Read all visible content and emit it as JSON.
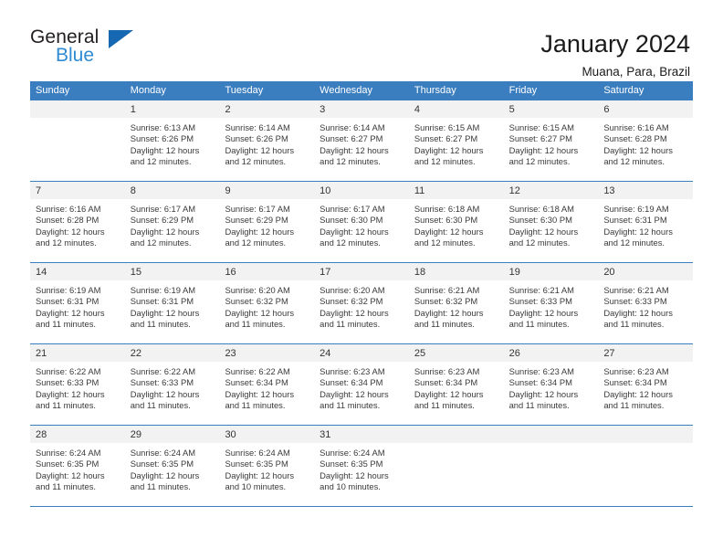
{
  "brand": {
    "name_part1": "General",
    "name_part2": "Blue",
    "triangle_color": "#1668b3",
    "blue_color": "#2e8bd4"
  },
  "header": {
    "title": "January 2024",
    "subtitle": "Muana, Para, Brazil"
  },
  "theme": {
    "header_blue": "#3b7ebf",
    "daynum_bg": "#f2f2f2",
    "text": "#3a3a3a"
  },
  "weekdays": [
    "Sunday",
    "Monday",
    "Tuesday",
    "Wednesday",
    "Thursday",
    "Friday",
    "Saturday"
  ],
  "labels": {
    "sunrise": "Sunrise:",
    "sunset": "Sunset:",
    "daylight": "Daylight:"
  },
  "weeks": [
    [
      {
        "day": ""
      },
      {
        "day": "1",
        "sunrise": "Sunrise: 6:13 AM",
        "sunset": "Sunset: 6:26 PM",
        "daylight1": "Daylight: 12 hours",
        "daylight2": "and 12 minutes."
      },
      {
        "day": "2",
        "sunrise": "Sunrise: 6:14 AM",
        "sunset": "Sunset: 6:26 PM",
        "daylight1": "Daylight: 12 hours",
        "daylight2": "and 12 minutes."
      },
      {
        "day": "3",
        "sunrise": "Sunrise: 6:14 AM",
        "sunset": "Sunset: 6:27 PM",
        "daylight1": "Daylight: 12 hours",
        "daylight2": "and 12 minutes."
      },
      {
        "day": "4",
        "sunrise": "Sunrise: 6:15 AM",
        "sunset": "Sunset: 6:27 PM",
        "daylight1": "Daylight: 12 hours",
        "daylight2": "and 12 minutes."
      },
      {
        "day": "5",
        "sunrise": "Sunrise: 6:15 AM",
        "sunset": "Sunset: 6:27 PM",
        "daylight1": "Daylight: 12 hours",
        "daylight2": "and 12 minutes."
      },
      {
        "day": "6",
        "sunrise": "Sunrise: 6:16 AM",
        "sunset": "Sunset: 6:28 PM",
        "daylight1": "Daylight: 12 hours",
        "daylight2": "and 12 minutes."
      }
    ],
    [
      {
        "day": "7",
        "sunrise": "Sunrise: 6:16 AM",
        "sunset": "Sunset: 6:28 PM",
        "daylight1": "Daylight: 12 hours",
        "daylight2": "and 12 minutes."
      },
      {
        "day": "8",
        "sunrise": "Sunrise: 6:17 AM",
        "sunset": "Sunset: 6:29 PM",
        "daylight1": "Daylight: 12 hours",
        "daylight2": "and 12 minutes."
      },
      {
        "day": "9",
        "sunrise": "Sunrise: 6:17 AM",
        "sunset": "Sunset: 6:29 PM",
        "daylight1": "Daylight: 12 hours",
        "daylight2": "and 12 minutes."
      },
      {
        "day": "10",
        "sunrise": "Sunrise: 6:17 AM",
        "sunset": "Sunset: 6:30 PM",
        "daylight1": "Daylight: 12 hours",
        "daylight2": "and 12 minutes."
      },
      {
        "day": "11",
        "sunrise": "Sunrise: 6:18 AM",
        "sunset": "Sunset: 6:30 PM",
        "daylight1": "Daylight: 12 hours",
        "daylight2": "and 12 minutes."
      },
      {
        "day": "12",
        "sunrise": "Sunrise: 6:18 AM",
        "sunset": "Sunset: 6:30 PM",
        "daylight1": "Daylight: 12 hours",
        "daylight2": "and 12 minutes."
      },
      {
        "day": "13",
        "sunrise": "Sunrise: 6:19 AM",
        "sunset": "Sunset: 6:31 PM",
        "daylight1": "Daylight: 12 hours",
        "daylight2": "and 12 minutes."
      }
    ],
    [
      {
        "day": "14",
        "sunrise": "Sunrise: 6:19 AM",
        "sunset": "Sunset: 6:31 PM",
        "daylight1": "Daylight: 12 hours",
        "daylight2": "and 11 minutes."
      },
      {
        "day": "15",
        "sunrise": "Sunrise: 6:19 AM",
        "sunset": "Sunset: 6:31 PM",
        "daylight1": "Daylight: 12 hours",
        "daylight2": "and 11 minutes."
      },
      {
        "day": "16",
        "sunrise": "Sunrise: 6:20 AM",
        "sunset": "Sunset: 6:32 PM",
        "daylight1": "Daylight: 12 hours",
        "daylight2": "and 11 minutes."
      },
      {
        "day": "17",
        "sunrise": "Sunrise: 6:20 AM",
        "sunset": "Sunset: 6:32 PM",
        "daylight1": "Daylight: 12 hours",
        "daylight2": "and 11 minutes."
      },
      {
        "day": "18",
        "sunrise": "Sunrise: 6:21 AM",
        "sunset": "Sunset: 6:32 PM",
        "daylight1": "Daylight: 12 hours",
        "daylight2": "and 11 minutes."
      },
      {
        "day": "19",
        "sunrise": "Sunrise: 6:21 AM",
        "sunset": "Sunset: 6:33 PM",
        "daylight1": "Daylight: 12 hours",
        "daylight2": "and 11 minutes."
      },
      {
        "day": "20",
        "sunrise": "Sunrise: 6:21 AM",
        "sunset": "Sunset: 6:33 PM",
        "daylight1": "Daylight: 12 hours",
        "daylight2": "and 11 minutes."
      }
    ],
    [
      {
        "day": "21",
        "sunrise": "Sunrise: 6:22 AM",
        "sunset": "Sunset: 6:33 PM",
        "daylight1": "Daylight: 12 hours",
        "daylight2": "and 11 minutes."
      },
      {
        "day": "22",
        "sunrise": "Sunrise: 6:22 AM",
        "sunset": "Sunset: 6:33 PM",
        "daylight1": "Daylight: 12 hours",
        "daylight2": "and 11 minutes."
      },
      {
        "day": "23",
        "sunrise": "Sunrise: 6:22 AM",
        "sunset": "Sunset: 6:34 PM",
        "daylight1": "Daylight: 12 hours",
        "daylight2": "and 11 minutes."
      },
      {
        "day": "24",
        "sunrise": "Sunrise: 6:23 AM",
        "sunset": "Sunset: 6:34 PM",
        "daylight1": "Daylight: 12 hours",
        "daylight2": "and 11 minutes."
      },
      {
        "day": "25",
        "sunrise": "Sunrise: 6:23 AM",
        "sunset": "Sunset: 6:34 PM",
        "daylight1": "Daylight: 12 hours",
        "daylight2": "and 11 minutes."
      },
      {
        "day": "26",
        "sunrise": "Sunrise: 6:23 AM",
        "sunset": "Sunset: 6:34 PM",
        "daylight1": "Daylight: 12 hours",
        "daylight2": "and 11 minutes."
      },
      {
        "day": "27",
        "sunrise": "Sunrise: 6:23 AM",
        "sunset": "Sunset: 6:34 PM",
        "daylight1": "Daylight: 12 hours",
        "daylight2": "and 11 minutes."
      }
    ],
    [
      {
        "day": "28",
        "sunrise": "Sunrise: 6:24 AM",
        "sunset": "Sunset: 6:35 PM",
        "daylight1": "Daylight: 12 hours",
        "daylight2": "and 11 minutes."
      },
      {
        "day": "29",
        "sunrise": "Sunrise: 6:24 AM",
        "sunset": "Sunset: 6:35 PM",
        "daylight1": "Daylight: 12 hours",
        "daylight2": "and 11 minutes."
      },
      {
        "day": "30",
        "sunrise": "Sunrise: 6:24 AM",
        "sunset": "Sunset: 6:35 PM",
        "daylight1": "Daylight: 12 hours",
        "daylight2": "and 10 minutes."
      },
      {
        "day": "31",
        "sunrise": "Sunrise: 6:24 AM",
        "sunset": "Sunset: 6:35 PM",
        "daylight1": "Daylight: 12 hours",
        "daylight2": "and 10 minutes."
      },
      {
        "day": ""
      },
      {
        "day": ""
      },
      {
        "day": ""
      }
    ]
  ]
}
